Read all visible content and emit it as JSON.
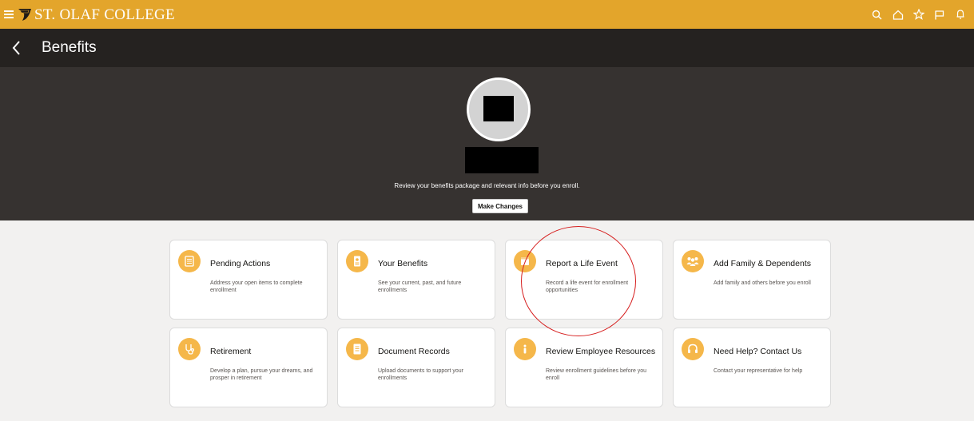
{
  "header": {
    "logo_text": "ST. OLAF COLLEGE",
    "icons": [
      "search-icon",
      "home-icon",
      "star-icon",
      "flag-icon",
      "bell-icon"
    ],
    "brand_color": "#e3a52b"
  },
  "titlebar": {
    "title": "Benefits"
  },
  "hero": {
    "message": "Review your benefits package and relevant info before you enroll.",
    "button_label": "Make Changes"
  },
  "tiles": [
    {
      "title": "Pending Actions",
      "description": "Address your open items to complete enrollment",
      "icon": "checklist-icon"
    },
    {
      "title": "Your Benefits",
      "description": "See your current, past, and future enrollments",
      "icon": "id-badge-icon"
    },
    {
      "title": "Report a Life Event",
      "description": "Record a life event for enrollment opportunities",
      "icon": "calendar-icon"
    },
    {
      "title": "Add Family & Dependents",
      "description": "Add family and others before you enroll",
      "icon": "family-icon"
    },
    {
      "title": "Retirement",
      "description": "Develop a plan, pursue your dreams, and prosper in retirement",
      "icon": "stethoscope-icon"
    },
    {
      "title": "Document Records",
      "description": "Upload documents to support your enrollments",
      "icon": "document-icon"
    },
    {
      "title": "Review Employee Resources",
      "description": "Review enrollment guidelines before you enroll",
      "icon": "info-icon"
    },
    {
      "title": "Need Help? Contact Us",
      "description": "Contact your representative for help",
      "icon": "headset-icon"
    }
  ],
  "colors": {
    "accent": "#e3a52b",
    "tile_icon": "#f5b74a",
    "annotation": "#d61f1f"
  }
}
